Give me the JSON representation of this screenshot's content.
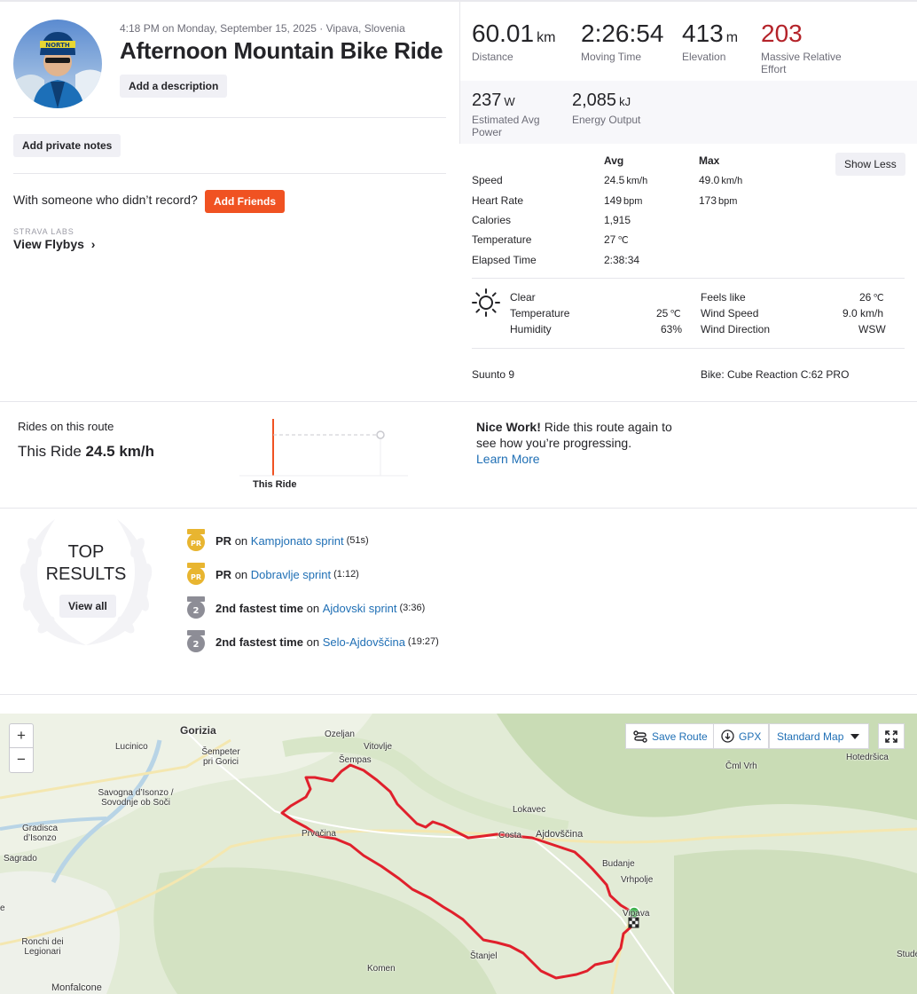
{
  "activity": {
    "meta": "4:18 PM on Monday, September 15, 2025 · Vipava, Slovenia",
    "title": "Afternoon Mountain Bike Ride",
    "add_description": "Add a description",
    "add_private_notes": "Add private notes",
    "with_someone": "With someone who didn’t record?",
    "add_friends": "Add Friends",
    "labs": "STRAVA LABS",
    "view_flybys": "View Flybys"
  },
  "stats": {
    "distance": {
      "value": "60.01",
      "unit": "km",
      "label": "Distance"
    },
    "moving_time": {
      "value": "2:26:54",
      "label": "Moving Time"
    },
    "elevation": {
      "value": "413",
      "unit": "m",
      "label": "Elevation"
    },
    "relative_effort": {
      "value": "203",
      "label": "Massive Relative Effort"
    },
    "power": {
      "value": "237",
      "unit": "W",
      "label": "Estimated Avg Power"
    },
    "energy": {
      "value": "2,085",
      "unit": "kJ",
      "label": "Energy Output"
    }
  },
  "details": {
    "avg_header": "Avg",
    "max_header": "Max",
    "show_less": "Show Less",
    "rows": [
      {
        "label": "Speed",
        "avg": "24.5",
        "avg_unit": "km/h",
        "max": "49.0",
        "max_unit": "km/h"
      },
      {
        "label": "Heart Rate",
        "avg": "149",
        "avg_unit": "bpm",
        "max": "173",
        "max_unit": "bpm"
      },
      {
        "label": "Calories",
        "avg": "1,915",
        "avg_unit": "",
        "max": "",
        "max_unit": ""
      },
      {
        "label": "Temperature",
        "avg": "27",
        "avg_unit": "℃",
        "max": "",
        "max_unit": ""
      },
      {
        "label": "Elapsed Time",
        "avg": "2:38:34",
        "avg_unit": "",
        "max": "",
        "max_unit": ""
      }
    ]
  },
  "weather": {
    "condition": "Clear",
    "temperature_label": "Temperature",
    "temperature": "25",
    "temperature_unit": "℃",
    "humidity_label": "Humidity",
    "humidity": "63%",
    "feels_like_label": "Feels like",
    "feels_like": "26",
    "feels_like_unit": "℃",
    "wind_speed_label": "Wind Speed",
    "wind_speed": "9.0 km/h",
    "wind_dir_label": "Wind Direction",
    "wind_dir": "WSW",
    "icon": "sun-icon"
  },
  "gear": {
    "device": "Suunto 9",
    "bike": "Bike: Cube Reaction C:62 PRO"
  },
  "route": {
    "title": "Rides on this route",
    "this_ride_prefix": "This Ride",
    "this_ride_speed": "24.5 km/h",
    "chart_label": "This Ride",
    "nice_bold": "Nice Work!",
    "nice_text": "Ride this route again to see how you’re progressing.",
    "learn_more": "Learn More"
  },
  "top_results": {
    "title_line1": "TOP",
    "title_line2": "RESULTS",
    "view_all": "View all",
    "items": [
      {
        "type": "pr",
        "badge": "PR",
        "bold": "PR",
        "on": "on",
        "segment": "Kampjonato sprint",
        "time": "(51s)"
      },
      {
        "type": "pr",
        "badge": "PR",
        "bold": "PR",
        "on": "on",
        "segment": "Dobravlje sprint",
        "time": "(1:12)"
      },
      {
        "type": "rank",
        "badge": "2",
        "bold": "2nd fastest time",
        "on": "on",
        "segment": "Ajdovski sprint",
        "time": "(3:36)"
      },
      {
        "type": "rank",
        "badge": "2",
        "bold": "2nd fastest time",
        "on": "on",
        "segment": "Selo-Ajdovščina",
        "time": "(19:27)"
      }
    ]
  },
  "map": {
    "zoom_in": "+",
    "zoom_out": "−",
    "save_route": "Save Route",
    "gpx": "GPX",
    "map_style": "Standard Map",
    "labels": {
      "gorizia": "Gorizia",
      "lucinico": "Lucinico",
      "sempeter": "Šempeter pri Gorici",
      "ozeljan": "Ozeljan",
      "vitovlje": "Vitovlje",
      "sempas": "Šempas",
      "savogna": "Savogna d’Isonzo / Sovodnje ob Soči",
      "gradisca": "Gradisca d’Isonzo",
      "sagrado": "Sagrado",
      "lokavec": "Lokavec",
      "ajdovscina": "Ajdovščina",
      "cmlvrh": "Čml Vrh",
      "hoted": "Hotedršica",
      "prvacina": "Prvačina",
      "costa": "Costa",
      "budanje": "Budanje",
      "vrhpolje": "Vrhpolje",
      "vipava": "Vipava",
      "ronchi": "Ronchi dei Legionari",
      "stanjel": "Štanjel",
      "komen": "Komen",
      "monfalcone": "Monfalcone",
      "studeno": "Stude",
      "edge_e": "e"
    }
  },
  "colors": {
    "brand_orange": "#f05222",
    "link_blue": "#1f6fb5",
    "effort_red": "#b4232a",
    "route_red": "#e0202c",
    "pr_gold": "#e8b530",
    "rank_gray": "#8d8d96"
  }
}
